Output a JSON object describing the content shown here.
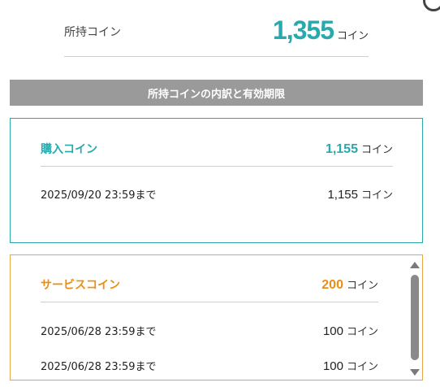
{
  "balance": {
    "label": "所持コイン",
    "value": "1,355",
    "unit": "コイン"
  },
  "breakdown_header": "所持コインの内訳と有効期限",
  "purchased": {
    "title": "購入コイン",
    "total": "1,155",
    "unit": "コイン",
    "rows": [
      {
        "expiry": "2025/09/20 23:59まで",
        "amount": "1,155",
        "unit": "コイン"
      }
    ]
  },
  "service": {
    "title": "サービスコイン",
    "total": "200",
    "unit": "コイン",
    "rows": [
      {
        "expiry": "2025/06/28 23:59まで",
        "amount": "100",
        "unit": "コイン"
      },
      {
        "expiry": "2025/06/28 23:59まで",
        "amount": "100",
        "unit": "コイン"
      }
    ]
  },
  "colors": {
    "teal": "#2aa9ad",
    "orange": "#ec8e12",
    "header_gray": "#9a9a9a"
  }
}
